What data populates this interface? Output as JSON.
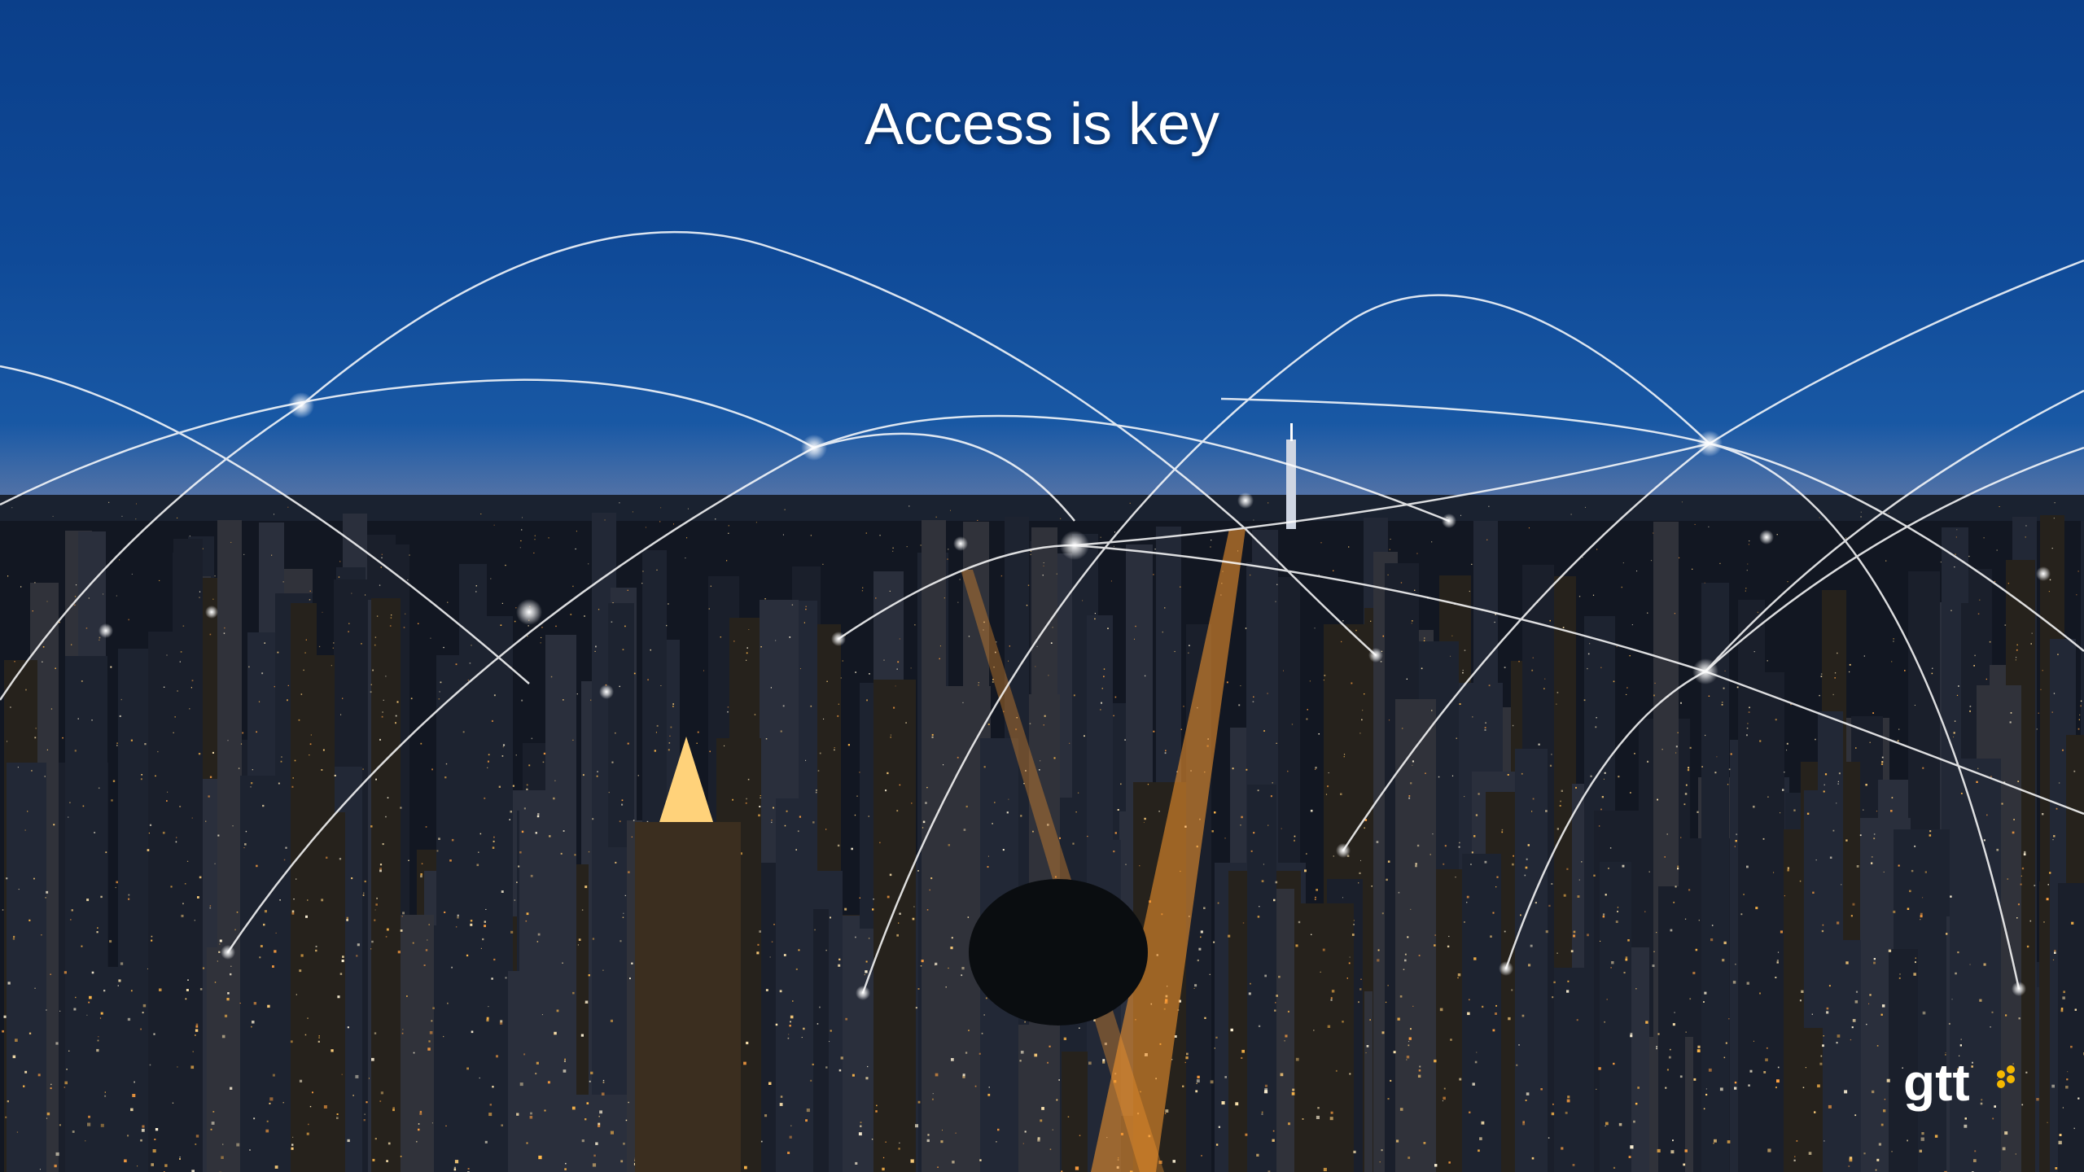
{
  "slide": {
    "title": "Access is key"
  },
  "logo": {
    "text": "gtt",
    "accent_color": "#f5b800"
  },
  "colors": {
    "sky_top": "#0b3f8a",
    "horizon": "#3a5f92",
    "city_lights": "#ffb84a",
    "network_lines": "#ffffff"
  },
  "background_image": "night-city-skyline-with-network-arcs"
}
